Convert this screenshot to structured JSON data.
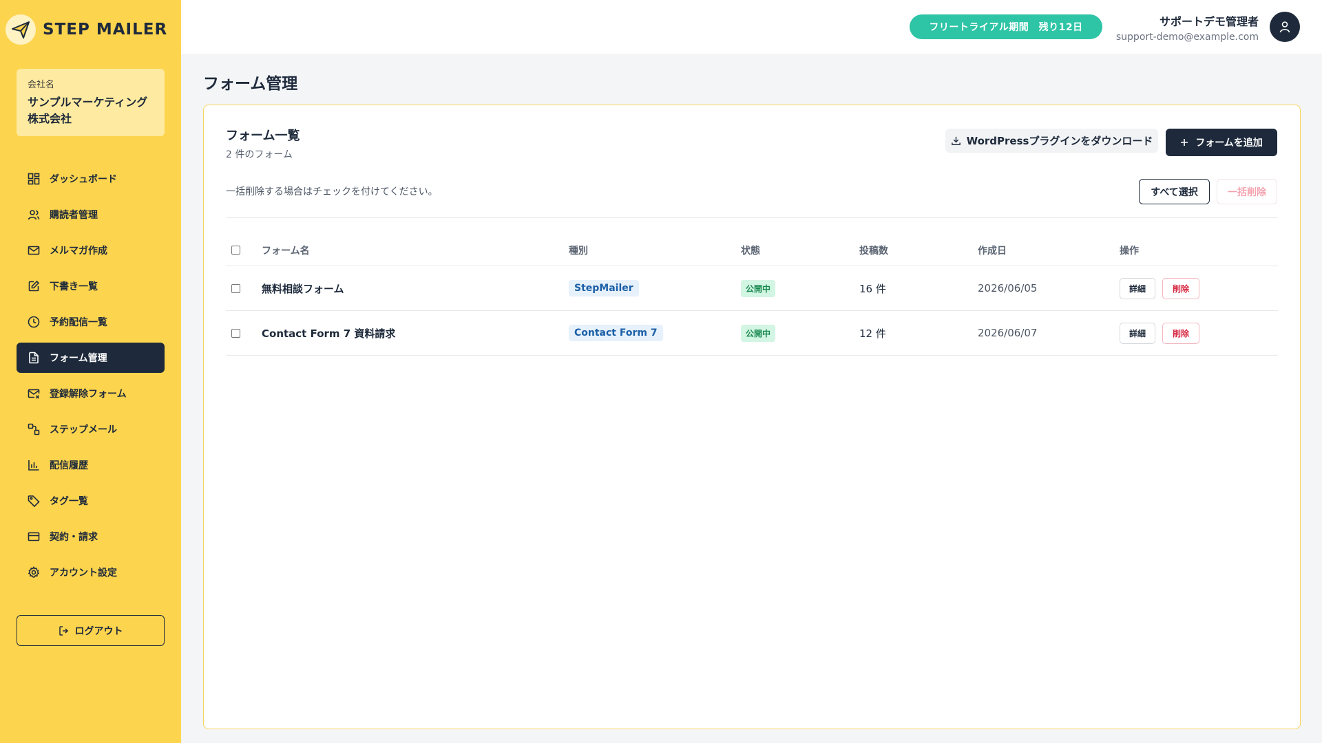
{
  "app": {
    "logo_text": "STEP MAILER",
    "logo_icon": "paper-plane-icon"
  },
  "company": {
    "label": "会社名",
    "name_line1": "サンプルマーケティング",
    "name_line2": "株式会社"
  },
  "sidebar": {
    "items": [
      {
        "label": "ダッシュボード",
        "icon": "dashboard-icon"
      },
      {
        "label": "購読者管理",
        "icon": "users-icon"
      },
      {
        "label": "メルマガ作成",
        "icon": "mail-icon"
      },
      {
        "label": "下書き一覧",
        "icon": "edit-icon"
      },
      {
        "label": "予約配信一覧",
        "icon": "clock-icon"
      },
      {
        "label": "フォーム管理",
        "icon": "file-icon",
        "active": true
      },
      {
        "label": "登録解除フォーム",
        "icon": "mail-x-icon"
      },
      {
        "label": "ステップメール",
        "icon": "workflow-icon"
      },
      {
        "label": "配信履歴",
        "icon": "bar-chart-icon"
      },
      {
        "label": "タグ一覧",
        "icon": "tag-icon"
      },
      {
        "label": "契約・請求",
        "icon": "credit-card-icon"
      },
      {
        "label": "アカウント設定",
        "icon": "gear-icon"
      }
    ],
    "logout_label": "ログアウト"
  },
  "header": {
    "trial_badge": "フリートライアル期間　残り12日",
    "user_name": "サポートデモ管理者",
    "user_email": "support-demo@example.com"
  },
  "main": {
    "page_title": "フォーム管理",
    "card_title": "フォーム一覧",
    "card_subtitle": "2 件のフォーム",
    "download_button": "WordPressプラグインをダウンロード",
    "add_button": "フォームを追加",
    "note": "一括削除する場合はチェックを付けてください。",
    "select_all_button": "すべて選択",
    "bulk_delete_button": "一括削除"
  },
  "table": {
    "headers": [
      "フォーム名",
      "種別",
      "状態",
      "投稿数",
      "作成日",
      "操作"
    ],
    "rows": [
      {
        "name": "無料相談フォーム",
        "type": "StepMailer",
        "status": "公開中",
        "count": "16 件",
        "date": "2026/06/05",
        "detail": "詳細",
        "delete": "削除"
      },
      {
        "name": "Contact Form 7 資料請求",
        "type": "Contact Form 7",
        "status": "公開中",
        "count": "12 件",
        "date": "2026/06/07",
        "detail": "詳細",
        "delete": "削除"
      }
    ]
  },
  "colors": {
    "sidebar": "#fdd44e",
    "accent_dark": "#1e2a3b",
    "trial": "#2ec4a6",
    "card_border": "#f7d55d"
  }
}
